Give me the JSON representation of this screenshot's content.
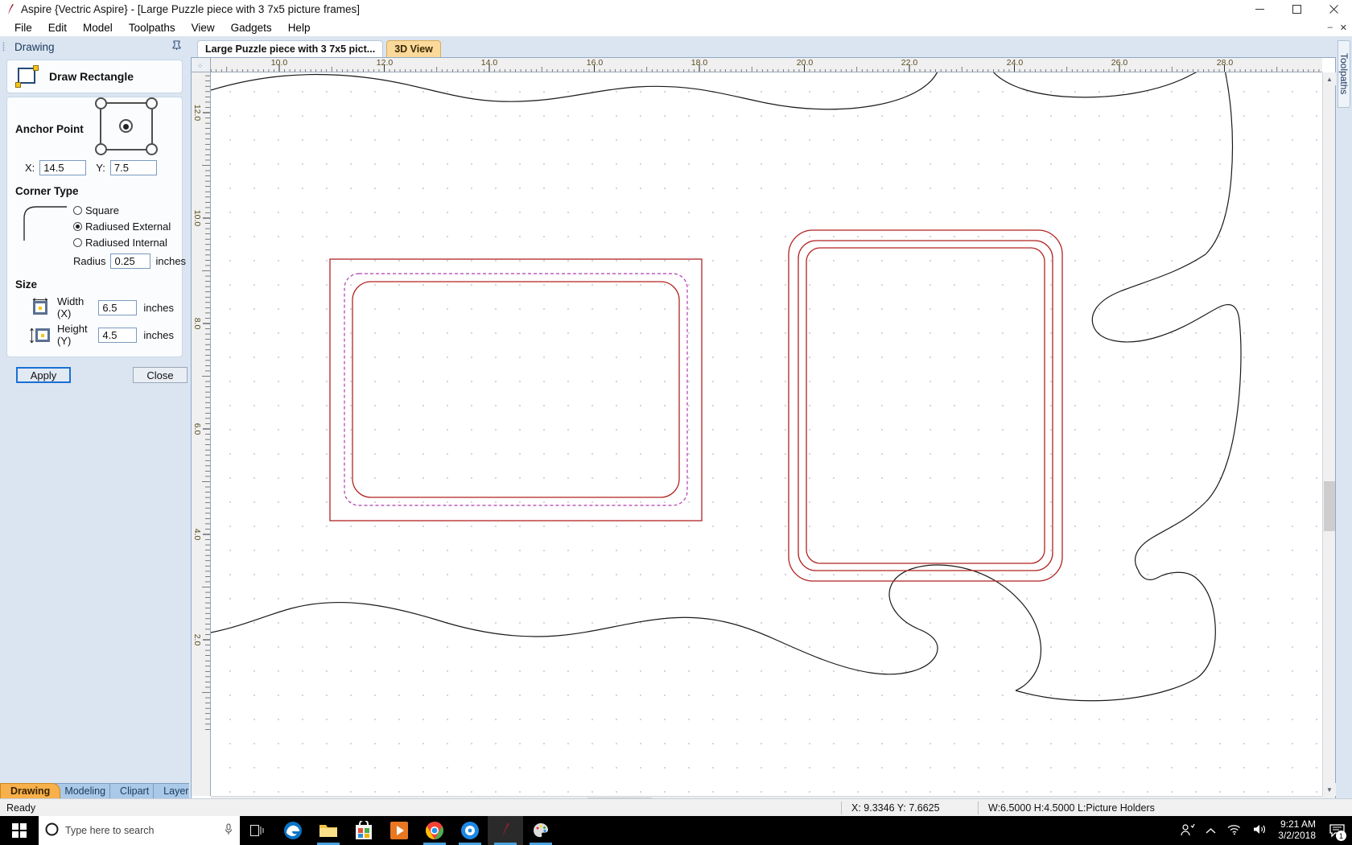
{
  "window": {
    "title": "Aspire {Vectric Aspire} - [Large Puzzle piece with 3 7x5 picture frames]",
    "app_icon": "aspire-logo-icon",
    "minimize": "–",
    "maximize": "❐",
    "close": "✕",
    "inner_minimize": "–",
    "inner_close": "✕"
  },
  "menu": {
    "items": [
      {
        "label": "File"
      },
      {
        "label": "Edit"
      },
      {
        "label": "Model"
      },
      {
        "label": "Toolpaths"
      },
      {
        "label": "View"
      },
      {
        "label": "Gadgets"
      },
      {
        "label": "Help"
      }
    ]
  },
  "left_panel": {
    "title": "Drawing",
    "pin_icon": "pin-icon",
    "tool": {
      "name": "Draw Rectangle",
      "icon": "rectangle-tool-icon"
    },
    "anchor": {
      "title": "Anchor Point",
      "x_label": "X:",
      "x_value": "14.5",
      "y_label": "Y:",
      "y_value": "7.5"
    },
    "corner": {
      "title": "Corner Type",
      "options": [
        {
          "label": "Square",
          "selected": false
        },
        {
          "label": "Radiused External",
          "selected": true
        },
        {
          "label": "Radiused Internal",
          "selected": false
        }
      ],
      "radius_label": "Radius",
      "radius_value": "0.25",
      "radius_units": "inches"
    },
    "size": {
      "title": "Size",
      "width_label": "Width (X)",
      "width_value": "6.5",
      "width_units": "inches",
      "height_label": "Height (Y)",
      "height_value": "4.5",
      "height_units": "inches"
    },
    "buttons": {
      "apply": "Apply",
      "close": "Close"
    },
    "tabs": [
      {
        "label": "Drawing",
        "active": true
      },
      {
        "label": "Modeling",
        "active": false
      },
      {
        "label": "Clipart",
        "active": false
      },
      {
        "label": "Layers",
        "active": false
      }
    ]
  },
  "document": {
    "tabs": [
      {
        "label": "Large Puzzle piece with 3 7x5 pict...",
        "active": true,
        "kind": "2d"
      },
      {
        "label": "3D View",
        "active": false,
        "kind": "3d"
      }
    ],
    "ruler_top_labels": [
      "10.0",
      "12.0",
      "14.0",
      "16.0",
      "18.0",
      "20.0",
      "22.0",
      "24.0",
      "26.0",
      "28.0"
    ],
    "ruler_left_labels": [
      "12.0",
      "10.0",
      "8.0",
      "6.0",
      "4.0",
      "2.0"
    ],
    "scrollbars": {
      "up_arrow": "▲",
      "down_arrow": "▼",
      "left_arrow": "◄",
      "right_arrow": "►"
    }
  },
  "right_dock": {
    "tab_label": "Toolpaths"
  },
  "status_bar": {
    "ready": "Ready",
    "cursor": "X:  9.3346 Y:  7.6625",
    "selection": "W:6.5000   H:4.5000  L:Picture Holders"
  },
  "taskbar": {
    "start_icon": "windows-start-icon",
    "search_icon": "cortana-circle-icon",
    "search_placeholder": "Type here to search",
    "mic_icon": "microphone-icon",
    "taskview_icon": "task-view-icon",
    "apps": [
      {
        "name": "edge-icon",
        "active": false,
        "running": false
      },
      {
        "name": "file-explorer-icon",
        "active": false,
        "running": true
      },
      {
        "name": "microsoft-store-icon",
        "active": false,
        "running": false
      },
      {
        "name": "movies-tv-icon",
        "active": false,
        "running": false
      },
      {
        "name": "google-chrome-icon",
        "active": false,
        "running": true
      },
      {
        "name": "media-player-icon",
        "active": false,
        "running": true
      },
      {
        "name": "vectric-aspire-icon",
        "active": true,
        "running": true
      },
      {
        "name": "paint-icon",
        "active": false,
        "running": true
      }
    ],
    "tray": {
      "people_icon": "people-icon",
      "chevron_icon": "show-hidden-icons-icon",
      "network_icon": "wifi-icon",
      "volume_icon": "speaker-icon",
      "time": "9:21 AM",
      "date": "3/2/2018",
      "notification_icon": "action-center-icon",
      "notification_count": "1"
    }
  },
  "colors": {
    "accent_blue": "#1a6fd4",
    "panel_blue": "#dbe5f1",
    "tab_orange": "#f7b04a",
    "geometry_red": "#b22222",
    "geometry_magenta": "#b23bb2",
    "puzzle_black": "#1a1a1a"
  }
}
